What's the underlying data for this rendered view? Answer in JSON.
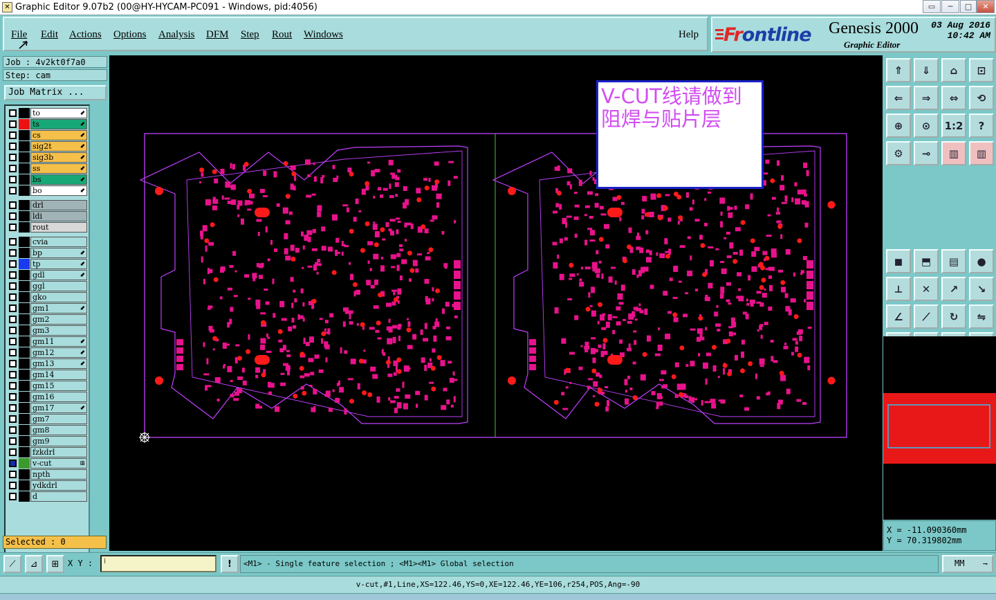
{
  "window": {
    "title": "Graphic Editor 9.07b2 (00@HY-HYCAM-PC091 - Windows, pid:4056)",
    "controls": [
      "▭",
      "─",
      "□",
      "✕"
    ]
  },
  "menu": {
    "items": [
      "File",
      "Edit",
      "Actions",
      "Options",
      "Analysis",
      "DFM",
      "Step",
      "Rout",
      "Windows"
    ],
    "help": "Help"
  },
  "brand": {
    "logo_a": "Fr",
    "logo_b": "ontline",
    "product": "Genesis 2000",
    "subtitle": "Graphic Editor",
    "date": "03 Aug 2016",
    "time": "10:42 AM"
  },
  "job": {
    "job_label": "Job : 4v2kt0f7a0",
    "step_label": "Step: cam",
    "matrix_button": "Job Matrix ..."
  },
  "layers": [
    {
      "name": "to",
      "bg": "#ffffff",
      "swatch": "#000000",
      "arrow": true
    },
    {
      "name": "ts",
      "bg": "#18a878",
      "swatch": "#ee1111",
      "arrow": true
    },
    {
      "name": "cs",
      "bg": "#f5c04a",
      "swatch": "#000000",
      "arrow": true
    },
    {
      "name": "sig2t",
      "bg": "#f5c04a",
      "swatch": "#000000",
      "arrow": true
    },
    {
      "name": "sig3b",
      "bg": "#f5c04a",
      "swatch": "#000000",
      "arrow": true
    },
    {
      "name": "ss",
      "bg": "#f5c04a",
      "swatch": "#000000",
      "arrow": true
    },
    {
      "name": "bs",
      "bg": "#18a878",
      "swatch": "#000000",
      "arrow": true
    },
    {
      "name": "bo",
      "bg": "#ffffff",
      "swatch": "#000000",
      "arrow": true
    },
    {
      "name": "drl",
      "bg": "#a0b4b8",
      "swatch": "#000000",
      "arrow": false
    },
    {
      "name": "ldi",
      "bg": "#a0b4b8",
      "swatch": "#000000",
      "arrow": false
    },
    {
      "name": "rout",
      "bg": "#d8d8d8",
      "swatch": "#000000",
      "arrow": false
    },
    {
      "name": "cvia",
      "bg": "#a9dcdc",
      "swatch": "#000000",
      "arrow": false
    },
    {
      "name": "bp",
      "bg": "#a9dcdc",
      "swatch": "#000000",
      "arrow": true
    },
    {
      "name": "tp",
      "bg": "#a9dcdc",
      "swatch": "#1a3aee",
      "arrow": true
    },
    {
      "name": "gdl",
      "bg": "#a9dcdc",
      "swatch": "#000000",
      "arrow": true
    },
    {
      "name": "ggl",
      "bg": "#a9dcdc",
      "swatch": "#000000",
      "arrow": false
    },
    {
      "name": "gko",
      "bg": "#a9dcdc",
      "swatch": "#000000",
      "arrow": false
    },
    {
      "name": "gm1",
      "bg": "#a9dcdc",
      "swatch": "#000000",
      "arrow": true
    },
    {
      "name": "gm2",
      "bg": "#a9dcdc",
      "swatch": "#000000",
      "arrow": false
    },
    {
      "name": "gm3",
      "bg": "#a9dcdc",
      "swatch": "#000000",
      "arrow": false
    },
    {
      "name": "gm11",
      "bg": "#a9dcdc",
      "swatch": "#000000",
      "arrow": true
    },
    {
      "name": "gm12",
      "bg": "#a9dcdc",
      "swatch": "#000000",
      "arrow": true
    },
    {
      "name": "gm13",
      "bg": "#a9dcdc",
      "swatch": "#000000",
      "arrow": true
    },
    {
      "name": "gm14",
      "bg": "#a9dcdc",
      "swatch": "#000000",
      "arrow": false
    },
    {
      "name": "gm15",
      "bg": "#a9dcdc",
      "swatch": "#000000",
      "arrow": false
    },
    {
      "name": "gm16",
      "bg": "#a9dcdc",
      "swatch": "#000000",
      "arrow": false
    },
    {
      "name": "gm17",
      "bg": "#a9dcdc",
      "swatch": "#000000",
      "arrow": true
    },
    {
      "name": "gm7",
      "bg": "#a9dcdc",
      "swatch": "#000000",
      "arrow": false
    },
    {
      "name": "gm8",
      "bg": "#a9dcdc",
      "swatch": "#000000",
      "arrow": false
    },
    {
      "name": "gm9",
      "bg": "#a9dcdc",
      "swatch": "#000000",
      "arrow": false
    },
    {
      "name": "fzkdrl",
      "bg": "#a9dcdc",
      "swatch": "#000000",
      "arrow": false
    },
    {
      "name": "v-cut",
      "bg": "#a9dcdc",
      "swatch": "#3a9a2a",
      "arrow": false,
      "active": true
    },
    {
      "name": "npth",
      "bg": "#a9dcdc",
      "swatch": "#000000",
      "arrow": false
    },
    {
      "name": "ydkdrl",
      "bg": "#a9dcdc",
      "swatch": "#000000",
      "arrow": false
    },
    {
      "name": "d",
      "bg": "#a9dcdc",
      "swatch": "#000000",
      "arrow": false
    }
  ],
  "selected": "Selected : 0",
  "annotation": "V-CUT线请做到\n阻焊与贴片层",
  "coords": {
    "x": "X  = -11.090360mm",
    "y": "Y  = 70.319802mm"
  },
  "bottom": {
    "xy_label": "X Y :",
    "xy_value": "⁞",
    "help_icon": "!",
    "message": "<M1> - Single feature selection ; <M1><M1> Global selection",
    "unit": "MM"
  },
  "status": "v-cut,#1,Line,XS=122.46,YS=0,XE=122.46,YE=106,r254,POS,Ang=-90",
  "colors": {
    "pad": "#e8128c",
    "pad_red": "#ff1a1a",
    "outline": "#c040ff",
    "vcut": "#3a9a2a"
  }
}
